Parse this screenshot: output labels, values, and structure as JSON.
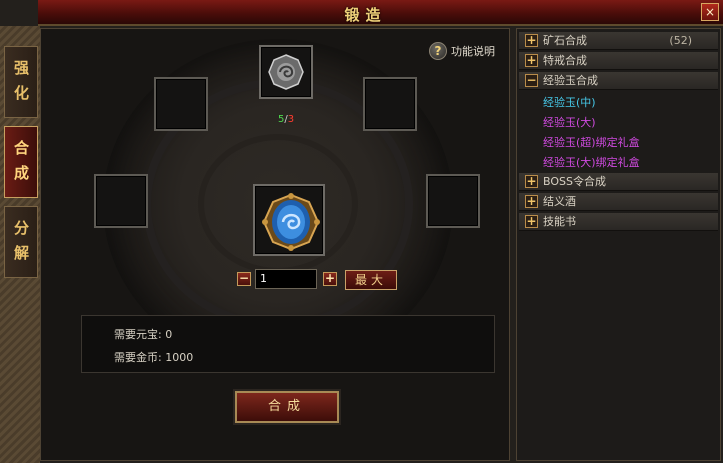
{
  "window": {
    "title": "锻造",
    "close_label": "×"
  },
  "tabs": [
    {
      "label": "强化",
      "active": false
    },
    {
      "label": "合成",
      "active": true
    },
    {
      "label": "分解",
      "active": false
    }
  ],
  "help": {
    "label": "功能说明",
    "icon": "?"
  },
  "ingredient": {
    "have": "5",
    "sep": "/",
    "need": "3"
  },
  "quantity": {
    "minus": "−",
    "value": "1",
    "plus": "+",
    "max_label": "最大"
  },
  "requirements": [
    {
      "label": "需要元宝: 0"
    },
    {
      "label": "需要金币: 1000"
    }
  ],
  "craft_button": "合成",
  "categories": [
    {
      "label": "矿石合成",
      "count": "(52)",
      "expanded": false
    },
    {
      "label": "特戒合成",
      "count": "",
      "expanded": false
    },
    {
      "label": "经验玉合成",
      "count": "",
      "expanded": true,
      "children": [
        {
          "label": "经验玉(中)",
          "color": "#46c8e8"
        },
        {
          "label": "经验玉(大)",
          "color": "#d04ae0"
        },
        {
          "label": "经验玉(超)绑定礼盒",
          "color": "#d04ae0"
        },
        {
          "label": "经验玉(大)绑定礼盒",
          "color": "#d04ae0"
        }
      ]
    },
    {
      "label": "BOSS令合成",
      "count": "",
      "expanded": false
    },
    {
      "label": "结义酒",
      "count": "",
      "expanded": false
    },
    {
      "label": "技能书",
      "count": "",
      "expanded": false
    }
  ],
  "colors": {
    "accent": "#f0d27a",
    "tab_active": "#6a1c14",
    "count_have": "#4ed94e",
    "count_need": "#ff3b2e"
  }
}
